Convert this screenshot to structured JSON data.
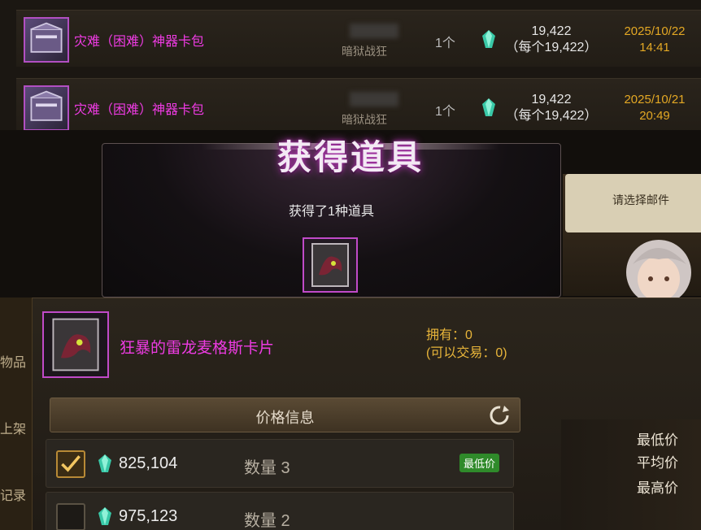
{
  "history": [
    {
      "item_name": "灾难（困难）神器卡包",
      "seller": "暗狱战狂",
      "quantity": "1个",
      "total_price": "19,422",
      "unit_price": "（每个19,422）",
      "date": "2025/10/22",
      "time": "14:41"
    },
    {
      "item_name": "灾难（困难）神器卡包",
      "seller": "暗狱战狂",
      "quantity": "1个",
      "total_price": "19,422",
      "unit_price": "（每个19,422）",
      "date": "2025/10/21",
      "time": "20:49"
    }
  ],
  "popup": {
    "title": "获得道具",
    "subtitle": "获得了1种道具"
  },
  "mail": {
    "prompt": "请选择邮件"
  },
  "sidebar": {
    "items": [
      "物品",
      "上架",
      "记录"
    ]
  },
  "item": {
    "name": "狂暴的雷龙麦格斯卡片",
    "owned": "拥有：0",
    "tradable": "(可以交易：0)"
  },
  "price_info": {
    "header": "价格信息",
    "listings": [
      {
        "price": "825,104",
        "quantity": "数量  3",
        "badge": "最低价",
        "checked": true
      },
      {
        "price": "975,123",
        "quantity": "数量  2",
        "badge": "",
        "checked": false
      }
    ]
  },
  "stats": {
    "min_label": "最低价",
    "avg_label": "平均价",
    "max_label": "最高价"
  },
  "colors": {
    "epic_item": "#ee3be3",
    "date_gold": "#e4a824",
    "badge_green": "#2f8a2a"
  }
}
